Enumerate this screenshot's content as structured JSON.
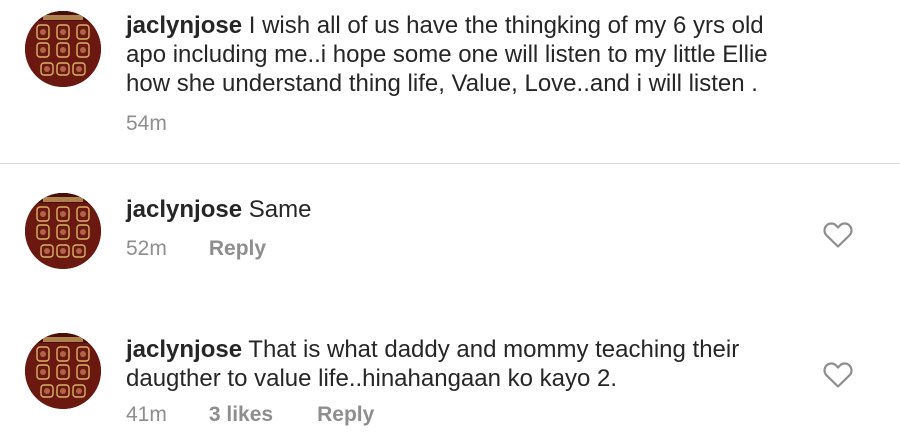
{
  "comments": [
    {
      "username": "jaclynjose",
      "text": " I wish all of us have the thingking of my 6 yrs old apo including me..i hope some one will listen to my little Ellie how she understand thing life, Value, Love..and i will listen .",
      "time": "54m"
    },
    {
      "username": "jaclynjose",
      "text": " Same",
      "time": "52m",
      "reply_label": "Reply",
      "icon": "heart-outline-icon"
    },
    {
      "username": "jaclynjose",
      "text": " That is what daddy and mommy teaching their daugther to value life..hinahangaan ko kayo 2.",
      "time": "41m",
      "likes": "3 likes",
      "reply_label": "Reply",
      "icon": "heart-outline-icon"
    }
  ],
  "colors": {
    "text": "#262626",
    "meta": "#8e8e8e",
    "divider": "#dbdbdb",
    "avatar_bg": "#6b1810",
    "avatar_frame": "#d8b26a"
  }
}
